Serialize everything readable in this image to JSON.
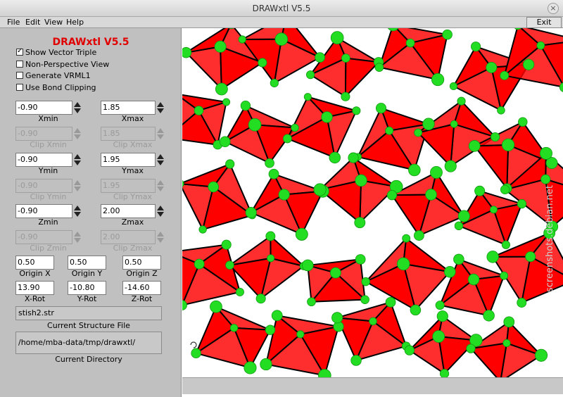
{
  "window": {
    "title": "DRAWxtl V5.5",
    "close_glyph": "×"
  },
  "menu": {
    "file": "File",
    "edit": "Edit",
    "view": "View",
    "help": "Help",
    "exit": "Exit"
  },
  "panel": {
    "app_title": "DRAWxtl V5.5",
    "options": [
      {
        "label": "Show Vector Triple",
        "checked": true
      },
      {
        "label": "Non-Perspective View",
        "checked": false
      },
      {
        "label": "Generate VRML1",
        "checked": false
      },
      {
        "label": "Use Bond Clipping",
        "checked": false
      }
    ],
    "xmin": {
      "value": "-0.90",
      "label": "Xmin"
    },
    "xmax": {
      "value": "1.85",
      "label": "Xmax"
    },
    "clip_xmin": {
      "value": "-0.90",
      "label": "Clip Xmin"
    },
    "clip_xmax": {
      "value": "1.85",
      "label": "Clip Xmax"
    },
    "ymin": {
      "value": "-0.90",
      "label": "Ymin"
    },
    "ymax": {
      "value": "1.95",
      "label": "Ymax"
    },
    "clip_ymin": {
      "value": "-0.90",
      "label": "Clip Ymin"
    },
    "clip_ymax": {
      "value": "1.95",
      "label": "Clip Ymax"
    },
    "zmin": {
      "value": "-0.90",
      "label": "Zmin"
    },
    "zmax": {
      "value": "2.00",
      "label": "Zmax"
    },
    "clip_zmin": {
      "value": "-0.90",
      "label": "Clip Zmin"
    },
    "clip_zmax": {
      "value": "2.00",
      "label": "Clip Zmax"
    },
    "origin_x": {
      "value": "0.50",
      "label": "Origin X"
    },
    "origin_y": {
      "value": "0.50",
      "label": "Origin Y"
    },
    "origin_z": {
      "value": "0.50",
      "label": "Origin Z"
    },
    "x_rot": {
      "value": "13.90",
      "label": "X-Rot"
    },
    "y_rot": {
      "value": "-10.80",
      "label": "Y-Rot"
    },
    "z_rot": {
      "value": "-14.60",
      "label": "Z-Rot"
    },
    "structure_file": {
      "value": "stish2.str",
      "label": "Current Structure File"
    },
    "directory": {
      "value": "/home/mba-data/tmp/drawxtl/",
      "label": "Current Directory"
    }
  },
  "viewport": {
    "polyhedron_color": "#ff0000",
    "edge_color": "#000000",
    "atom_color": "#22dd22",
    "watermark_text": "screenshots.debian.net"
  }
}
